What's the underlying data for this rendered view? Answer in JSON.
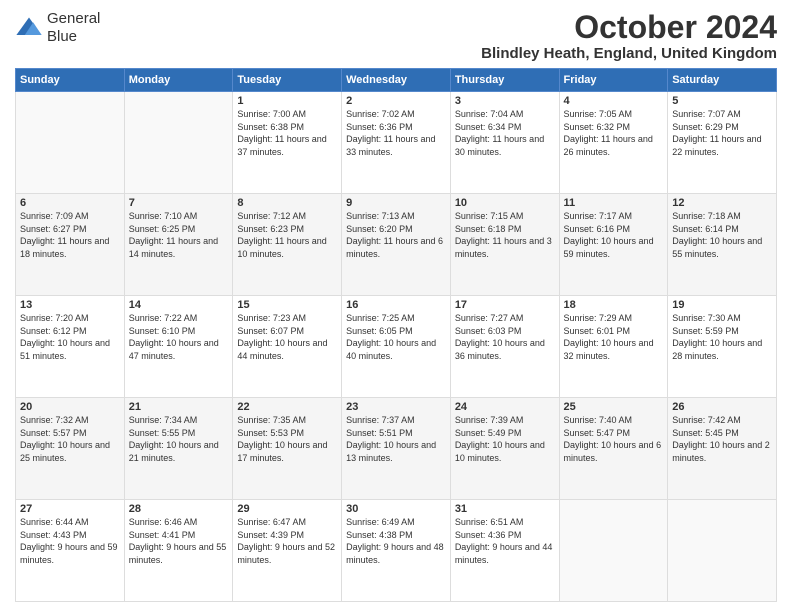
{
  "header": {
    "logo_line1": "General",
    "logo_line2": "Blue",
    "month": "October 2024",
    "location": "Blindley Heath, England, United Kingdom"
  },
  "days_of_week": [
    "Sunday",
    "Monday",
    "Tuesday",
    "Wednesday",
    "Thursday",
    "Friday",
    "Saturday"
  ],
  "weeks": [
    [
      {
        "day": "",
        "sunrise": "",
        "sunset": "",
        "daylight": ""
      },
      {
        "day": "",
        "sunrise": "",
        "sunset": "",
        "daylight": ""
      },
      {
        "day": "1",
        "sunrise": "Sunrise: 7:00 AM",
        "sunset": "Sunset: 6:38 PM",
        "daylight": "Daylight: 11 hours and 37 minutes."
      },
      {
        "day": "2",
        "sunrise": "Sunrise: 7:02 AM",
        "sunset": "Sunset: 6:36 PM",
        "daylight": "Daylight: 11 hours and 33 minutes."
      },
      {
        "day": "3",
        "sunrise": "Sunrise: 7:04 AM",
        "sunset": "Sunset: 6:34 PM",
        "daylight": "Daylight: 11 hours and 30 minutes."
      },
      {
        "day": "4",
        "sunrise": "Sunrise: 7:05 AM",
        "sunset": "Sunset: 6:32 PM",
        "daylight": "Daylight: 11 hours and 26 minutes."
      },
      {
        "day": "5",
        "sunrise": "Sunrise: 7:07 AM",
        "sunset": "Sunset: 6:29 PM",
        "daylight": "Daylight: 11 hours and 22 minutes."
      }
    ],
    [
      {
        "day": "6",
        "sunrise": "Sunrise: 7:09 AM",
        "sunset": "Sunset: 6:27 PM",
        "daylight": "Daylight: 11 hours and 18 minutes."
      },
      {
        "day": "7",
        "sunrise": "Sunrise: 7:10 AM",
        "sunset": "Sunset: 6:25 PM",
        "daylight": "Daylight: 11 hours and 14 minutes."
      },
      {
        "day": "8",
        "sunrise": "Sunrise: 7:12 AM",
        "sunset": "Sunset: 6:23 PM",
        "daylight": "Daylight: 11 hours and 10 minutes."
      },
      {
        "day": "9",
        "sunrise": "Sunrise: 7:13 AM",
        "sunset": "Sunset: 6:20 PM",
        "daylight": "Daylight: 11 hours and 6 minutes."
      },
      {
        "day": "10",
        "sunrise": "Sunrise: 7:15 AM",
        "sunset": "Sunset: 6:18 PM",
        "daylight": "Daylight: 11 hours and 3 minutes."
      },
      {
        "day": "11",
        "sunrise": "Sunrise: 7:17 AM",
        "sunset": "Sunset: 6:16 PM",
        "daylight": "Daylight: 10 hours and 59 minutes."
      },
      {
        "day": "12",
        "sunrise": "Sunrise: 7:18 AM",
        "sunset": "Sunset: 6:14 PM",
        "daylight": "Daylight: 10 hours and 55 minutes."
      }
    ],
    [
      {
        "day": "13",
        "sunrise": "Sunrise: 7:20 AM",
        "sunset": "Sunset: 6:12 PM",
        "daylight": "Daylight: 10 hours and 51 minutes."
      },
      {
        "day": "14",
        "sunrise": "Sunrise: 7:22 AM",
        "sunset": "Sunset: 6:10 PM",
        "daylight": "Daylight: 10 hours and 47 minutes."
      },
      {
        "day": "15",
        "sunrise": "Sunrise: 7:23 AM",
        "sunset": "Sunset: 6:07 PM",
        "daylight": "Daylight: 10 hours and 44 minutes."
      },
      {
        "day": "16",
        "sunrise": "Sunrise: 7:25 AM",
        "sunset": "Sunset: 6:05 PM",
        "daylight": "Daylight: 10 hours and 40 minutes."
      },
      {
        "day": "17",
        "sunrise": "Sunrise: 7:27 AM",
        "sunset": "Sunset: 6:03 PM",
        "daylight": "Daylight: 10 hours and 36 minutes."
      },
      {
        "day": "18",
        "sunrise": "Sunrise: 7:29 AM",
        "sunset": "Sunset: 6:01 PM",
        "daylight": "Daylight: 10 hours and 32 minutes."
      },
      {
        "day": "19",
        "sunrise": "Sunrise: 7:30 AM",
        "sunset": "Sunset: 5:59 PM",
        "daylight": "Daylight: 10 hours and 28 minutes."
      }
    ],
    [
      {
        "day": "20",
        "sunrise": "Sunrise: 7:32 AM",
        "sunset": "Sunset: 5:57 PM",
        "daylight": "Daylight: 10 hours and 25 minutes."
      },
      {
        "day": "21",
        "sunrise": "Sunrise: 7:34 AM",
        "sunset": "Sunset: 5:55 PM",
        "daylight": "Daylight: 10 hours and 21 minutes."
      },
      {
        "day": "22",
        "sunrise": "Sunrise: 7:35 AM",
        "sunset": "Sunset: 5:53 PM",
        "daylight": "Daylight: 10 hours and 17 minutes."
      },
      {
        "day": "23",
        "sunrise": "Sunrise: 7:37 AM",
        "sunset": "Sunset: 5:51 PM",
        "daylight": "Daylight: 10 hours and 13 minutes."
      },
      {
        "day": "24",
        "sunrise": "Sunrise: 7:39 AM",
        "sunset": "Sunset: 5:49 PM",
        "daylight": "Daylight: 10 hours and 10 minutes."
      },
      {
        "day": "25",
        "sunrise": "Sunrise: 7:40 AM",
        "sunset": "Sunset: 5:47 PM",
        "daylight": "Daylight: 10 hours and 6 minutes."
      },
      {
        "day": "26",
        "sunrise": "Sunrise: 7:42 AM",
        "sunset": "Sunset: 5:45 PM",
        "daylight": "Daylight: 10 hours and 2 minutes."
      }
    ],
    [
      {
        "day": "27",
        "sunrise": "Sunrise: 6:44 AM",
        "sunset": "Sunset: 4:43 PM",
        "daylight": "Daylight: 9 hours and 59 minutes."
      },
      {
        "day": "28",
        "sunrise": "Sunrise: 6:46 AM",
        "sunset": "Sunset: 4:41 PM",
        "daylight": "Daylight: 9 hours and 55 minutes."
      },
      {
        "day": "29",
        "sunrise": "Sunrise: 6:47 AM",
        "sunset": "Sunset: 4:39 PM",
        "daylight": "Daylight: 9 hours and 52 minutes."
      },
      {
        "day": "30",
        "sunrise": "Sunrise: 6:49 AM",
        "sunset": "Sunset: 4:38 PM",
        "daylight": "Daylight: 9 hours and 48 minutes."
      },
      {
        "day": "31",
        "sunrise": "Sunrise: 6:51 AM",
        "sunset": "Sunset: 4:36 PM",
        "daylight": "Daylight: 9 hours and 44 minutes."
      },
      {
        "day": "",
        "sunrise": "",
        "sunset": "",
        "daylight": ""
      },
      {
        "day": "",
        "sunrise": "",
        "sunset": "",
        "daylight": ""
      }
    ]
  ]
}
